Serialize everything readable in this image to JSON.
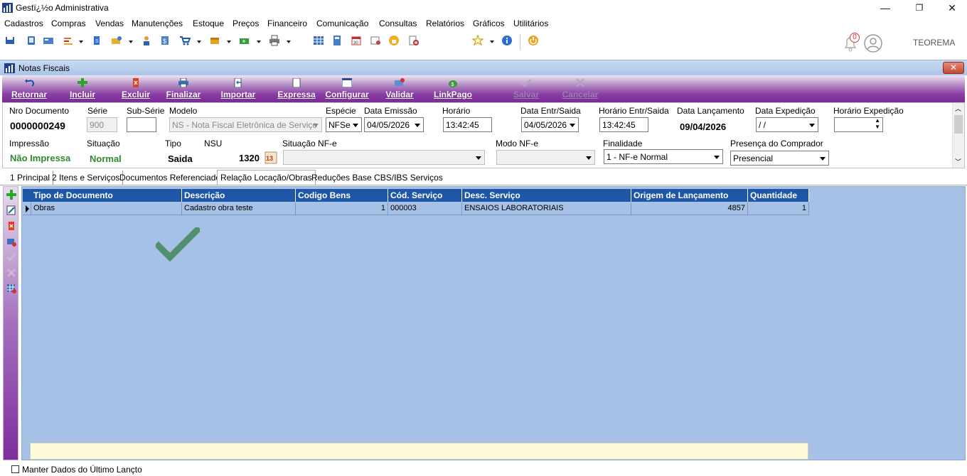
{
  "window": {
    "title": "Gestï¿½o Administrativa",
    "minimize": "—",
    "restore": "❐",
    "close": "✕"
  },
  "menu": [
    "Cadastros",
    "Compras",
    "Vendas",
    "Manutenções",
    "Estoque",
    "Preços",
    "Financeiro",
    "Comunicação",
    "Consultas",
    "Relatórios",
    "Gráficos",
    "Utilitários"
  ],
  "toolbar": {
    "notification_count": "0",
    "user": "TEOREMA"
  },
  "child": {
    "title": "Notas Fiscais",
    "close": "✕"
  },
  "actions": {
    "retornar": "Retornar",
    "incluir": "Incluir",
    "excluir": "Excluir",
    "finalizar": "Finalizar",
    "importar": "Importar",
    "expressa": "Expressa",
    "configurar": "Configurar",
    "validar": "Validar",
    "linkpago": "LinkPago",
    "salvar": "Salvar",
    "cancelar": "Cancelar"
  },
  "form": {
    "nro_documento_label": "Nro Documento",
    "nro_documento": "0000000249",
    "serie_label": "Série",
    "serie": "900",
    "subserie_label": "Sub-Série",
    "subserie": "",
    "modelo_label": "Modelo",
    "modelo": "NS - Nota Fiscal Eletrônica de Serviço",
    "especie_label": "Espécie",
    "especie": "NFSe",
    "data_emissao_label": "Data Emissão",
    "data_emissao": "04/05/2026",
    "horario_label": "Horário",
    "horario": "13:42:45",
    "data_entr_label": "Data Entr/Saida",
    "data_entr": "04/05/2026",
    "horario_entr_label": "Horário Entr/Saida",
    "horario_entr": "13:42:45",
    "data_lanc_label": "Data Lançamento",
    "data_lanc": "09/04/2026",
    "data_exped_label": "Data Expedição",
    "data_exped": " /  /",
    "horario_exped_label": "Horário Expedição",
    "horario_exped": "",
    "impressao_label": "Impressão",
    "impressao": "Não Impressa",
    "situacao_label": "Situação",
    "situacao": "Normal",
    "tipo_label": "Tipo",
    "tipo": "Saida",
    "nsu_label": "NSU",
    "nsu": "1320",
    "situacao_nfe_label": "Situação NF-e",
    "situacao_nfe": "",
    "modo_nfe_label": "Modo NF-e",
    "modo_nfe": "",
    "finalidade_label": "Finalidade",
    "finalidade": "1 - NF-e Normal",
    "presenca_label": "Presença do Comprador",
    "presenca": "Presencial"
  },
  "tabs": [
    "1 Principal",
    "2 Itens e Serviços",
    "Documentos Referenciados",
    "Relação Locação/Obras",
    "Reduções Base CBS/IBS Serviços"
  ],
  "grid": {
    "columns": [
      "Tipo de Documento",
      "Descrição",
      "Codigo Bens",
      "Cód. Serviço",
      "Desc. Serviço",
      "Origem de Lançamento",
      "Quantidade"
    ],
    "rows": [
      [
        "Obras",
        "Cadastro obra teste",
        "1",
        "000003",
        "ENSAIOS LABORATORIAIS",
        "4857",
        "1"
      ]
    ]
  },
  "bottom": {
    "keep_data_label": "Manter Dados do Último Lançto"
  },
  "colors": {
    "purple": "#7a2b96",
    "grid_header": "#1f57a8",
    "grid_bg": "#a7c1e6",
    "green_text": "#2d8a2d"
  }
}
